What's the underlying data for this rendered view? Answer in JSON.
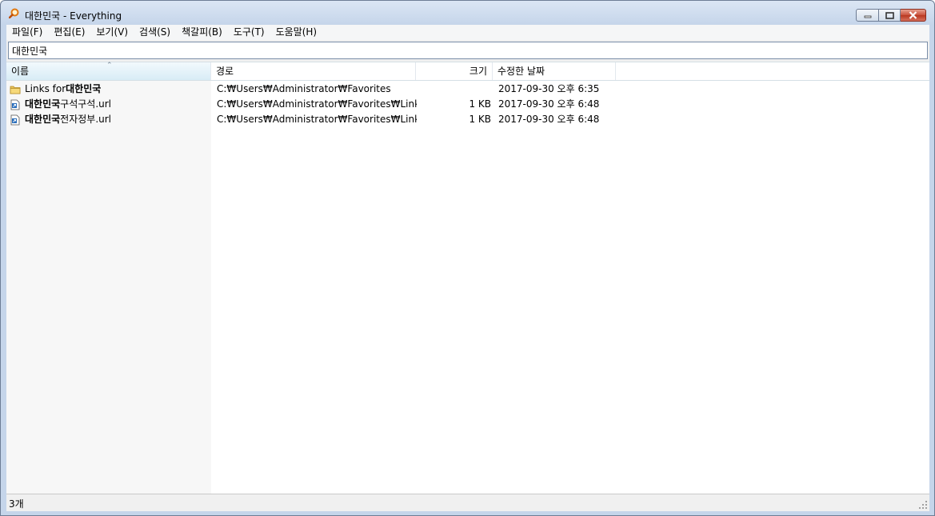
{
  "window": {
    "title": "대한민국 - Everything"
  },
  "menu": [
    "파일(F)",
    "편집(E)",
    "보기(V)",
    "검색(S)",
    "책갈피(B)",
    "도구(T)",
    "도움말(H)"
  ],
  "search": {
    "value": "대한민국"
  },
  "columns": {
    "name": "이름",
    "path": "경로",
    "size": "크기",
    "date": "수정한 날짜"
  },
  "rows": [
    {
      "icon": "folder-icon",
      "name_prefix": "Links for ",
      "name_bold": "대한민국",
      "name_suffix": "",
      "path": "C:₩Users₩Administrator₩Favorites",
      "size": "",
      "date": "2017-09-30 오후 6:35"
    },
    {
      "icon": "url-shortcut-icon",
      "name_prefix": "",
      "name_bold": "대한민국",
      "name_suffix": " 구석구석.url",
      "path": "C:₩Users₩Administrator₩Favorites₩Links fo...",
      "size": "1 KB",
      "date": "2017-09-30 오후 6:48"
    },
    {
      "icon": "url-shortcut-icon",
      "name_prefix": "",
      "name_bold": "대한민국",
      "name_suffix": " 전자정부.url",
      "path": "C:₩Users₩Administrator₩Favorites₩Links fo...",
      "size": "1 KB",
      "date": "2017-09-30 오후 6:48"
    }
  ],
  "status": {
    "count": "3개"
  },
  "colors": {
    "accent_close": "#c9503b",
    "sorted_header": "#d8ecf6"
  }
}
